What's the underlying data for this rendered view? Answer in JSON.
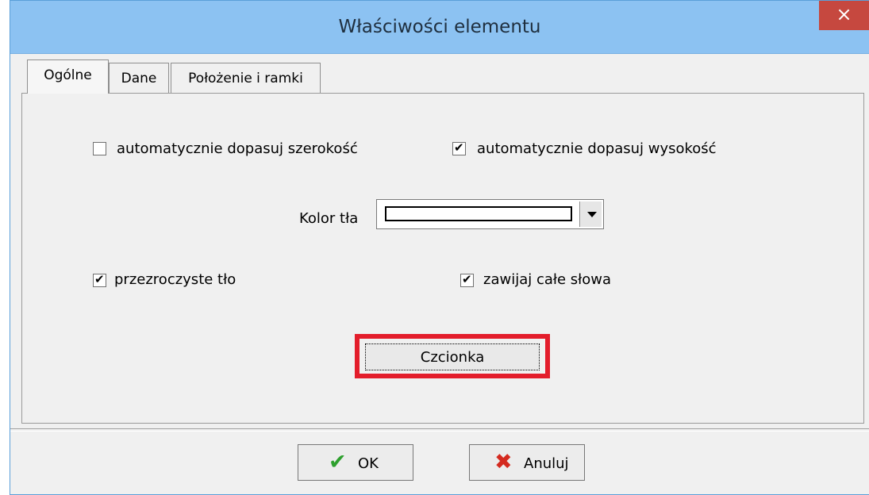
{
  "window": {
    "title": "Właściwości elementu",
    "close_label": "×"
  },
  "tabs": [
    {
      "label": "Ogólne",
      "active": true
    },
    {
      "label": "Dane",
      "active": false
    },
    {
      "label": "Położenie i ramki",
      "active": false
    }
  ],
  "options": {
    "auto_width": {
      "label": "automatycznie dopasuj szerokość",
      "checked": false
    },
    "auto_height": {
      "label": "automatycznie dopasuj wysokość",
      "checked": true
    },
    "transparent_bg": {
      "label": "przezroczyste tło",
      "checked": true
    },
    "wrap_words": {
      "label": "zawijaj całe słowa",
      "checked": true
    }
  },
  "background_color": {
    "label": "Kolor tła",
    "value_color": "#ffffff"
  },
  "font_button": {
    "label": "Czcionka",
    "highlight_color": "#e31d2b"
  },
  "footer": {
    "ok": {
      "label": "OK",
      "icon": "checkmark-icon"
    },
    "cancel": {
      "label": "Anuluj",
      "icon": "x-icon"
    }
  }
}
